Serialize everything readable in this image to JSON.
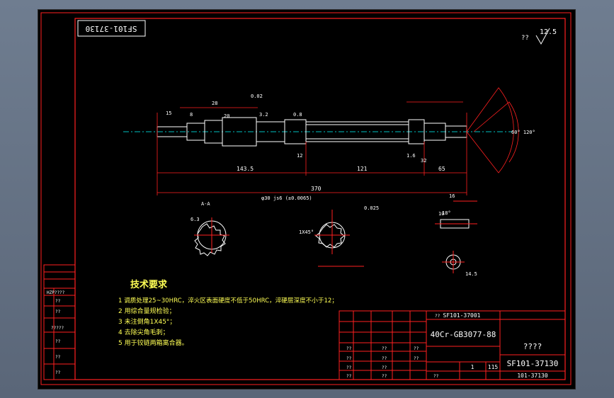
{
  "title_block": {
    "drawing_no_top": "SF101-37130",
    "parent_assembly": "SF101-37001",
    "material": "40Cr-GB3077-88",
    "part_name": "????",
    "drawing_no": "SF101-37130",
    "drawing_no_bottom": "101-37130",
    "quantity": "1",
    "code": "115",
    "placeholder": "??"
  },
  "surface_roughness": {
    "value": "12.5",
    "note": "??"
  },
  "tech_requirements": {
    "heading": "技术要求",
    "items": [
      "1  调质处理25~30HRC，淬火区表面硬度不低于50HRC，淬硬层深度不小于12；",
      "2  用综合量规检验；",
      "3  未注倒角1X45°；",
      "4  去除尖角毛刺；",
      "5  用于铰链两箱离合器。"
    ]
  },
  "side_table": [
    "HZP????",
    "??",
    "??",
    "?????",
    "??",
    "??",
    "??"
  ],
  "dimensions": {
    "total_length": "370",
    "left_segment": "143.5",
    "middle_segment": "121",
    "right_segment": "65",
    "bore": "φ30 js6 (±0.0065)",
    "section_label": "A-A",
    "chamfer": "1X45°",
    "angle": "60° 120°",
    "small_dims": [
      "15",
      "8",
      "28",
      "20",
      "12",
      "32",
      "3.2",
      "6.3",
      "1.6",
      "0.8",
      "16",
      "10",
      "14.5",
      "18°",
      "0.025",
      "0.02"
    ]
  }
}
